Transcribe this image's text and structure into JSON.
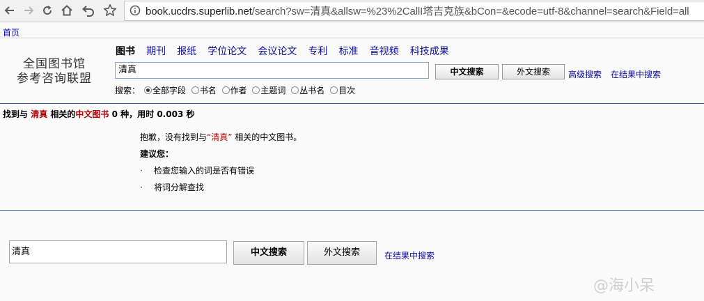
{
  "browser": {
    "url_host": "book.ucdrs.superlib.net",
    "url_rest": "/search?sw=清真&allsw=%23%2CallI塔吉克族&bCon=&ecode=utf-8&channel=search&Field=all"
  },
  "header": {
    "home_link": "首页",
    "logo_line1": "全国图书馆",
    "logo_line2": "参考咨询联盟",
    "tabs": [
      {
        "label": "图书"
      },
      {
        "label": "期刊"
      },
      {
        "label": "报纸"
      },
      {
        "label": "学位论文"
      },
      {
        "label": "会议论文"
      },
      {
        "label": "专利"
      },
      {
        "label": "标准"
      },
      {
        "label": "音视频"
      },
      {
        "label": "科技成果"
      }
    ]
  },
  "search": {
    "value": "清真",
    "button_cn": "中文搜索",
    "button_foreign": "外文搜索",
    "advanced": "高级搜索",
    "within": "在结果中搜索",
    "scope_label": "搜索：",
    "scope_options": [
      "全部字段",
      "书名",
      "作者",
      "主题词",
      "丛书名",
      "目次"
    ],
    "scope_selected": "全部字段"
  },
  "result": {
    "prefix": "找到与",
    "keyword": "清真",
    "middle": "相关的",
    "category": "中文图书",
    "count_text": "0 种，用时 0.003 秒"
  },
  "message": {
    "sorry_prefix": "抱歉，没有找到与",
    "sorry_keyword": "“清真”",
    "sorry_suffix": "相关的中文图书。",
    "suggest_title": "建议您：",
    "tips": [
      "检查您输入的词是否有错误",
      "将词分解查找"
    ]
  },
  "bottom": {
    "value": "清真",
    "button_cn": "中文搜索",
    "button_foreign": "外文搜索",
    "within": "在结果中搜索"
  },
  "watermark": "@海小呆"
}
